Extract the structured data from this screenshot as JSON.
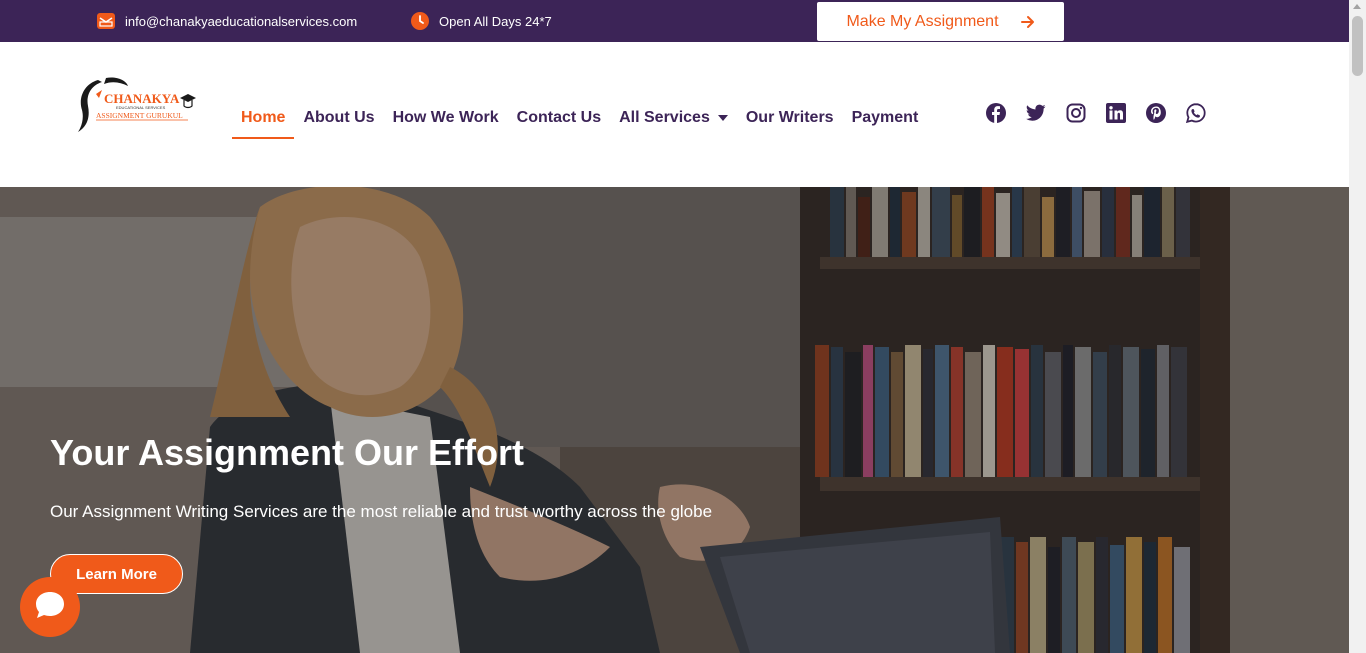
{
  "topbar": {
    "email": "info@chanakyaeducationalservices.com",
    "hours": "Open All Days 24*7",
    "cta_label": "Make My Assignment"
  },
  "logo": {
    "name": "CHANAKYA",
    "tagline": "EDUCATIONAL SERVICES",
    "subtitle": "ASSIGNMENT GURUKUL"
  },
  "nav": {
    "items": [
      {
        "label": "Home"
      },
      {
        "label": "About Us"
      },
      {
        "label": "How We Work"
      },
      {
        "label": "Contact Us"
      },
      {
        "label": "All Services"
      },
      {
        "label": "Our Writers"
      },
      {
        "label": "Payment"
      }
    ],
    "active_index": 0
  },
  "social": [
    "facebook-icon",
    "twitter-icon",
    "instagram-icon",
    "linkedin-icon",
    "pinterest-icon",
    "whatsapp-icon"
  ],
  "hero": {
    "title": "Your Assignment Our Effort",
    "subtitle": "Our Assignment Writing Services are the most reliable and trust worthy across the globe",
    "button_label": "Learn More"
  },
  "colors": {
    "brand_purple": "#3c2457",
    "accent_orange": "#f05a1a"
  }
}
